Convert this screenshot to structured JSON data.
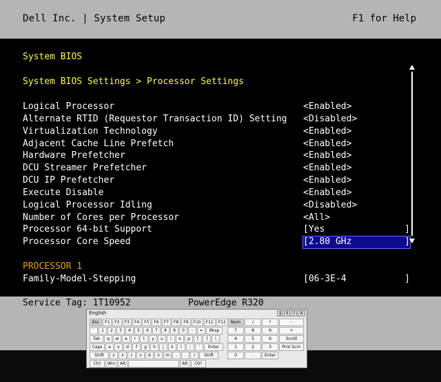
{
  "header": {
    "title": "Dell Inc. | System Setup",
    "help": "F1 for Help"
  },
  "bios": {
    "title": "System BIOS",
    "breadcrumb": "System BIOS Settings > Processor Settings",
    "settings": [
      {
        "label": "Logical Processor",
        "value": "<Enabled>"
      },
      {
        "label": "Alternate RTID (Requestor Transaction ID) Setting",
        "value": "<Disabled>"
      },
      {
        "label": "Virtualization Technology",
        "value": "<Enabled>"
      },
      {
        "label": "Adjacent Cache Line Prefetch",
        "value": "<Enabled>"
      },
      {
        "label": "Hardware Prefetcher",
        "value": "<Enabled>"
      },
      {
        "label": "DCU Streamer Prefetcher",
        "value": "<Enabled>"
      },
      {
        "label": "DCU IP Prefetcher",
        "value": "<Enabled>"
      },
      {
        "label": "Execute Disable",
        "value": "<Enabled>"
      },
      {
        "label": "Logical Processor Idling",
        "value": "<Disabled>"
      },
      {
        "label": "Number of Cores per Processor",
        "value": "<All>"
      }
    ],
    "fields": [
      {
        "label": "Processor 64-bit Support",
        "value": "Yes"
      },
      {
        "label": "Processor Core Speed",
        "value": "2.80 GHz"
      }
    ],
    "section_header": "PROCESSOR 1",
    "section_fields": [
      {
        "label": "Family-Model-Stepping",
        "value": "06-3E-4"
      }
    ],
    "bracket_open": "[",
    "bracket_close": "]"
  },
  "footer": {
    "service_tag": "Service Tag: 1T10952",
    "model": "PowerEdge R320"
  },
  "keyboard": {
    "title": "English",
    "controls": [
      "∥",
      "↕",
      "?",
      "X"
    ],
    "rows": [
      [
        "Esc",
        "F1",
        "F2",
        "F3",
        "F4",
        "F5",
        "F6",
        "F7",
        "F8",
        "F9",
        "F10",
        "F11",
        "F12"
      ],
      [
        "`",
        "1",
        "2",
        "3",
        "4",
        "5",
        "6",
        "7",
        "8",
        "9",
        "0",
        "-",
        "=",
        "Bksp"
      ],
      [
        "Tab",
        "q",
        "w",
        "e",
        "r",
        "t",
        "y",
        "u",
        "i",
        "o",
        "p",
        "[",
        "]",
        "\\"
      ],
      [
        "Caps",
        "a",
        "s",
        "d",
        "f",
        "g",
        "h",
        "j",
        "k",
        "l",
        ";",
        "'",
        "Enter"
      ],
      [
        "Shift",
        "z",
        "x",
        "c",
        "v",
        "b",
        "n",
        "m",
        ",",
        ".",
        "/",
        "Shift"
      ],
      [
        "Ctrl",
        "Win",
        "Alt",
        "",
        "Alt",
        "Ctrl"
      ]
    ],
    "numpad": [
      [
        "Num",
        "/",
        "*",
        "-"
      ],
      [
        "7",
        "8",
        "9",
        "+"
      ],
      [
        "4",
        "5",
        "6",
        "Scroll"
      ],
      [
        "1",
        "2",
        "3",
        "Prnt Scrn"
      ],
      [
        "0",
        ".",
        "Enter"
      ]
    ]
  },
  "colors": {
    "chrome": "#b5b5b5",
    "accent_yellow": "#ffff33",
    "section_orange": "#e8a000",
    "selection_blue": "#0d0a8e"
  }
}
